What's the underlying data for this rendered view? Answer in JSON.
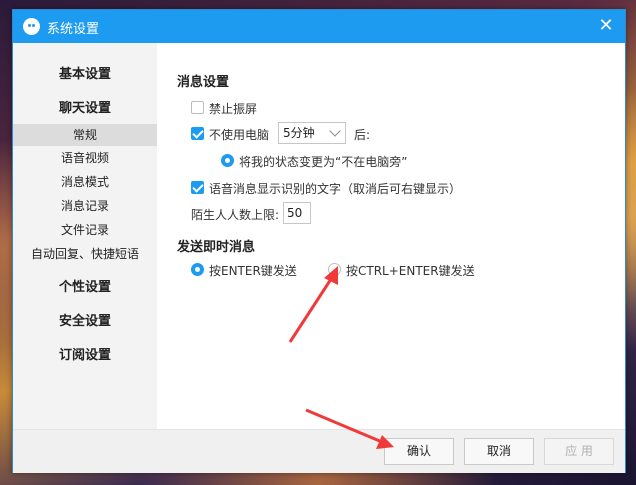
{
  "window": {
    "title": "系统设置"
  },
  "sidebar": {
    "categories": [
      "基本设置",
      "聊天设置",
      "个性设置",
      "安全设置",
      "订阅设置"
    ],
    "chat_items": [
      "常规",
      "语音视频",
      "消息模式",
      "消息记录",
      "文件记录",
      "自动回复、快捷短语"
    ],
    "active_item": "常规"
  },
  "message_settings": {
    "title": "消息设置",
    "disable_shake": {
      "label": "禁止振屏",
      "checked": false
    },
    "idle": {
      "label": "不使用电脑",
      "checked": true,
      "duration": "5分钟",
      "after": "后:",
      "status_option": "将我的状态变更为“不在电脑旁”"
    },
    "voice_text": {
      "label": "语音消息显示识别的文字（取消后可右键显示）",
      "checked": true
    },
    "stranger_limit": {
      "label": "陌生人人数上限:",
      "value": "50"
    }
  },
  "send_settings": {
    "title": "发送即时消息",
    "option_enter": {
      "label": "按ENTER键发送",
      "selected": true
    },
    "option_ctrl_enter": {
      "label": "按CTRL+ENTER键发送",
      "selected": false
    }
  },
  "footer": {
    "confirm": "确认",
    "cancel": "取消",
    "apply": "应 用"
  },
  "colors": {
    "accent": "#1d9bf0",
    "arrow": "#f03a3a"
  }
}
